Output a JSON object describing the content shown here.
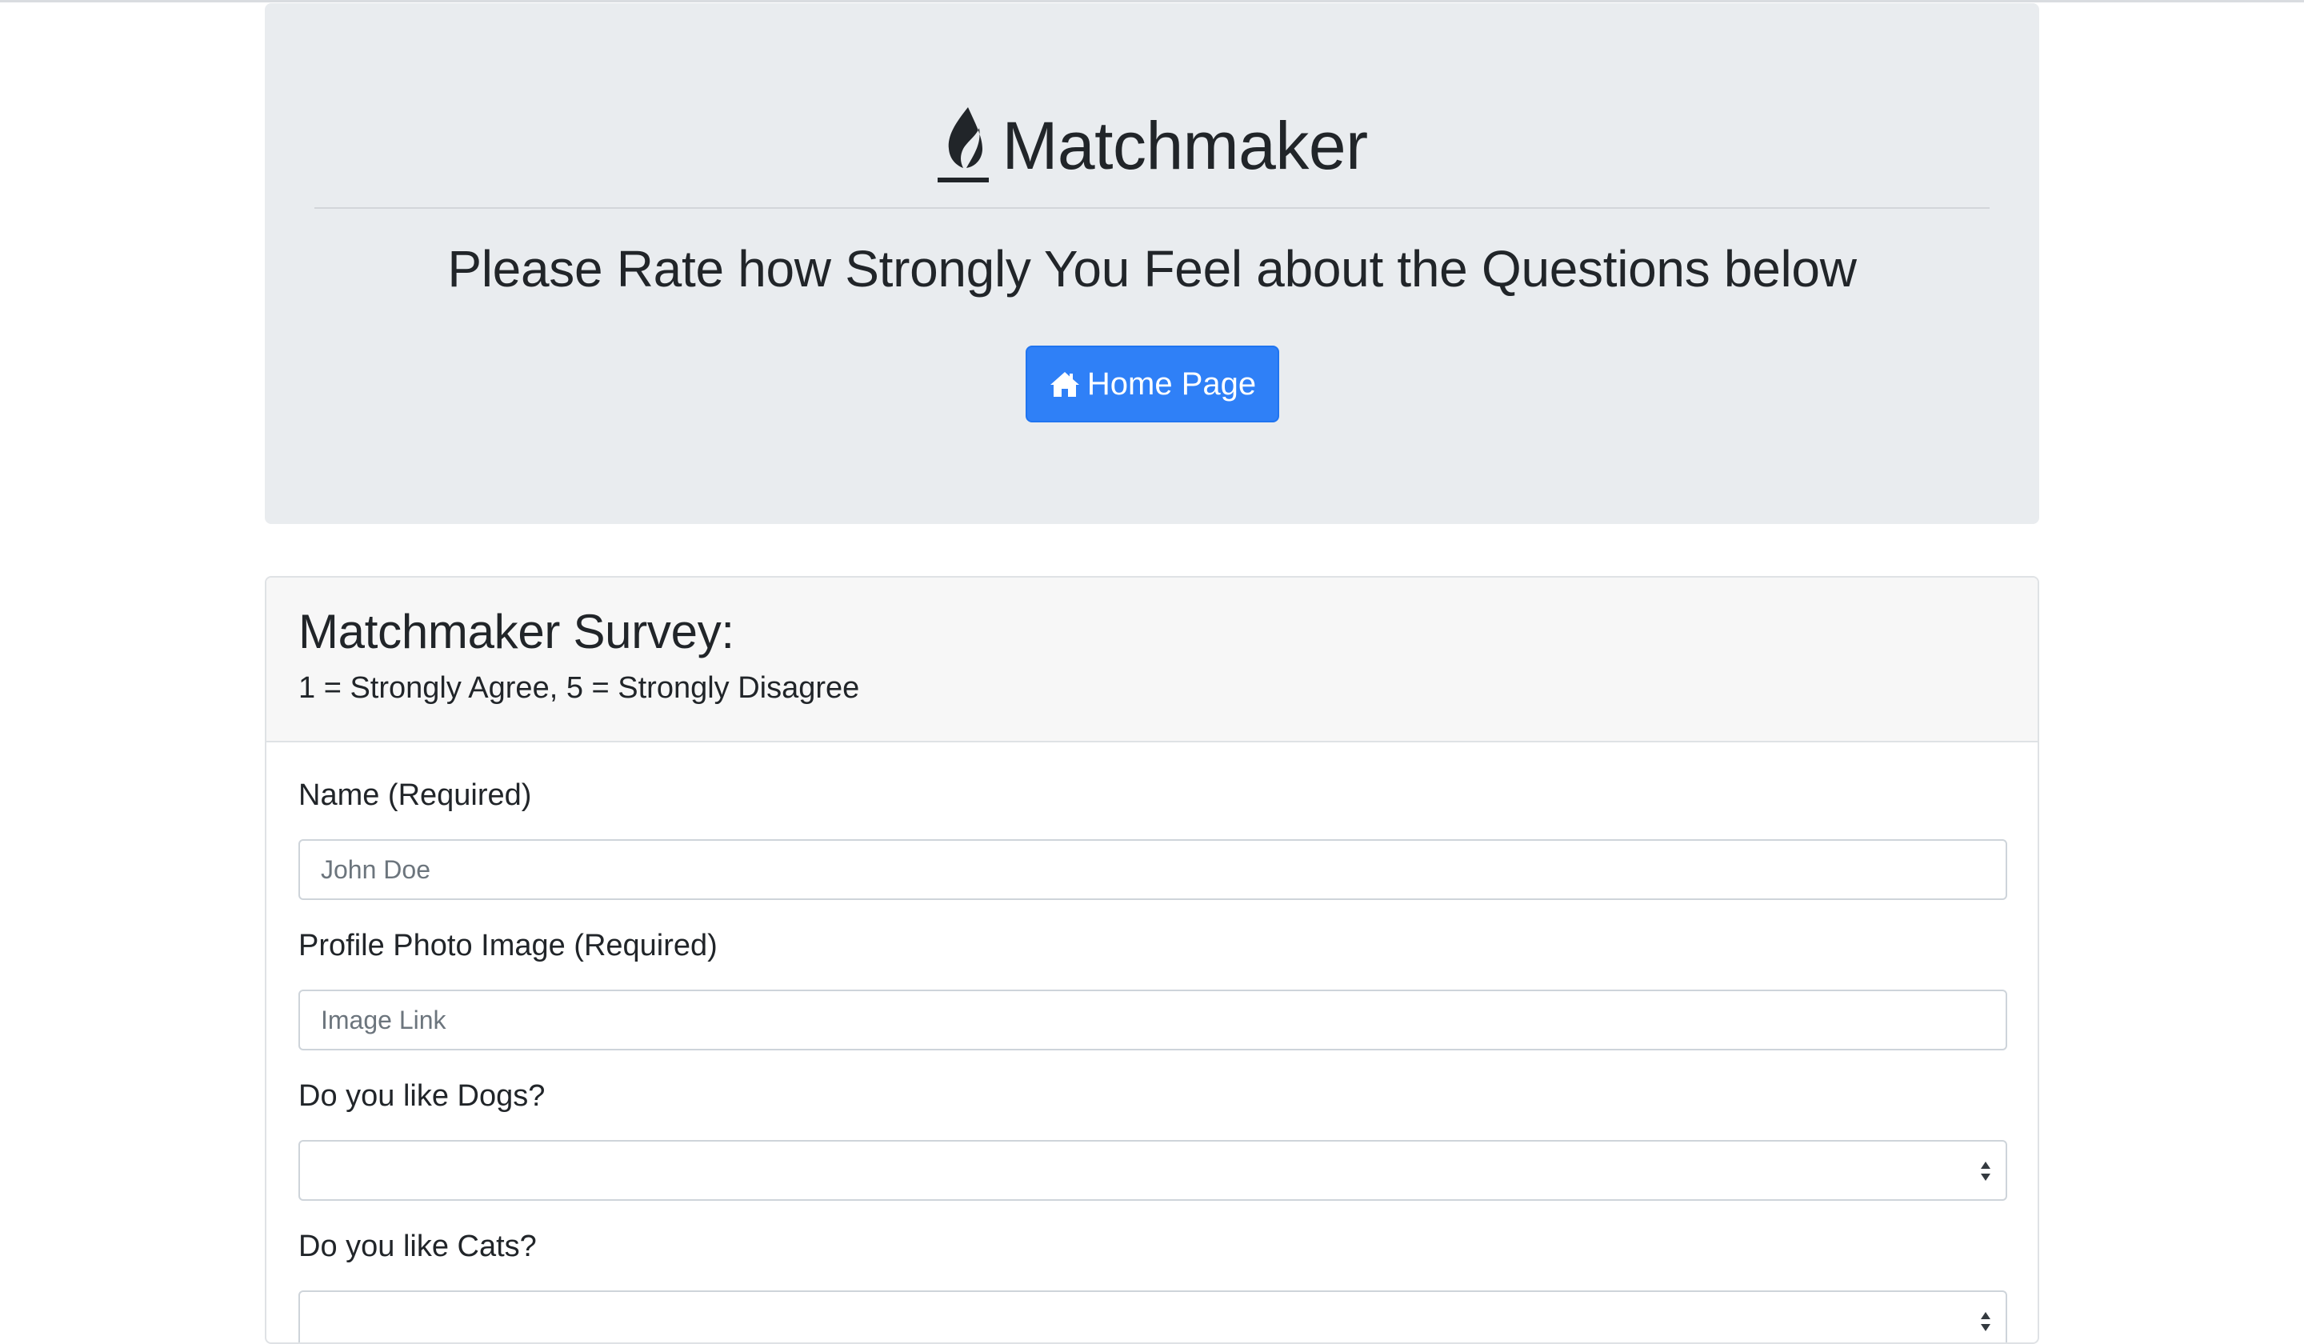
{
  "header": {
    "brand_icon": "fire-icon",
    "title": "Matchmaker",
    "subtitle": "Please Rate how Strongly You Feel about the Questions below",
    "home_button": {
      "icon": "home-icon",
      "label": "Home Page"
    }
  },
  "survey": {
    "title": "Matchmaker Survey:",
    "legend": "1 = Strongly Agree, 5 = Strongly Disagree",
    "fields": {
      "name": {
        "label": "Name (Required)",
        "placeholder": "John Doe",
        "value": ""
      },
      "photo": {
        "label": "Profile Photo Image (Required)",
        "placeholder": "Image Link",
        "value": ""
      },
      "dogs": {
        "label": "Do you like Dogs?",
        "selected": ""
      },
      "cats": {
        "label": "Do you like Cats?",
        "selected": ""
      }
    }
  },
  "colors": {
    "jumbotron_bg": "#e9ecef",
    "primary": "#2f80f7",
    "card_header_bg": "#f7f7f7",
    "text": "#212529"
  }
}
